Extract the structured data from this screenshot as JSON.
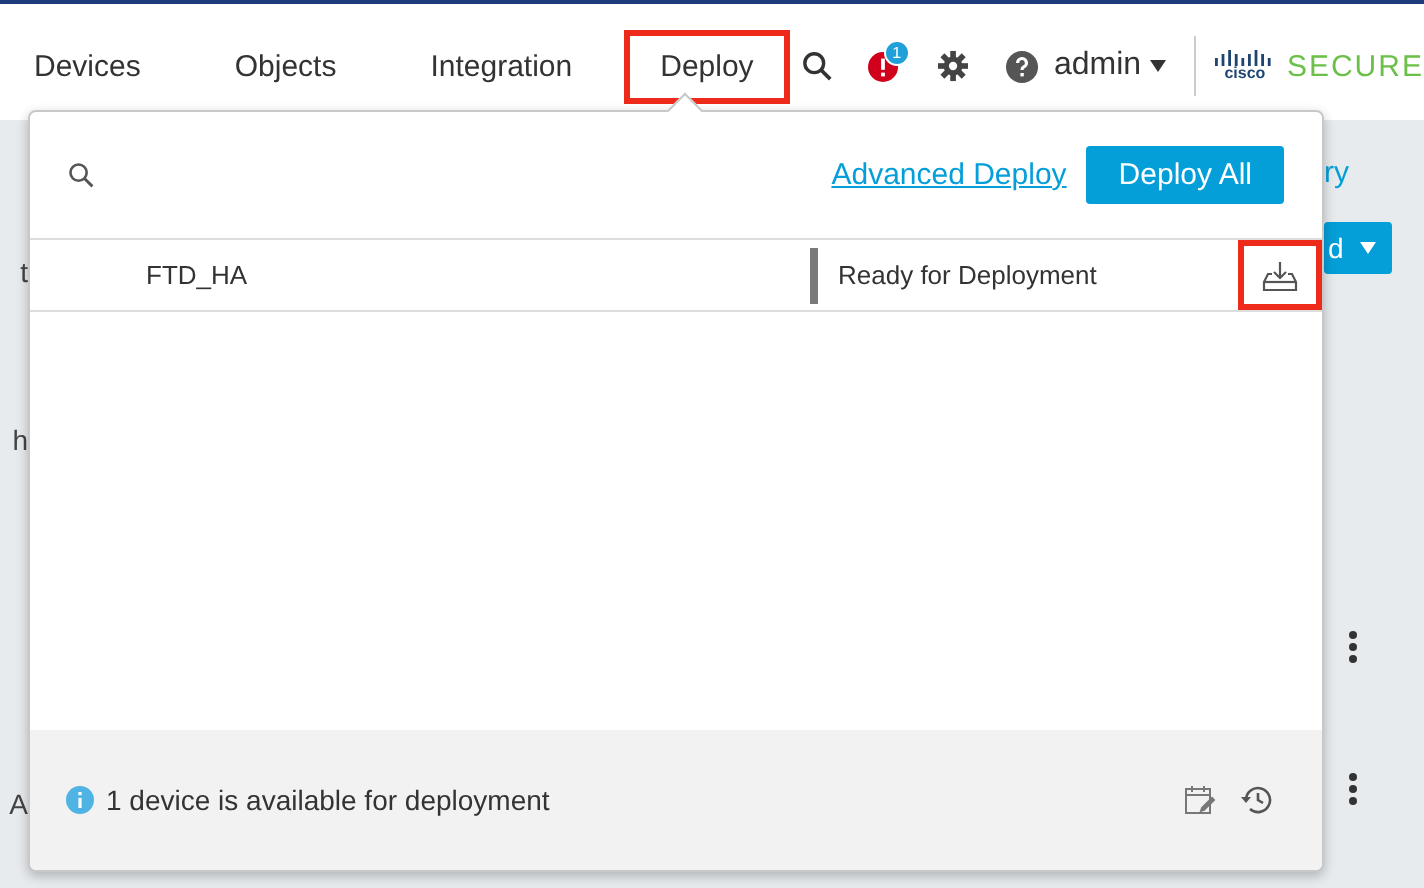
{
  "nav": {
    "items": [
      {
        "label": "Devices",
        "highlighted": false
      },
      {
        "label": "Objects",
        "highlighted": false
      },
      {
        "label": "Integration",
        "highlighted": false
      },
      {
        "label": "Deploy",
        "highlighted": true
      }
    ],
    "alert_count": "1",
    "user": "admin",
    "logo_text": "cisco",
    "brand": "SECURE"
  },
  "background": {
    "left_fragments": [
      "t",
      "h",
      "A"
    ],
    "right_link": "ry",
    "right_button": "d"
  },
  "deploy_panel": {
    "advanced_link": "Advanced Deploy",
    "deploy_all": "Deploy All",
    "devices": [
      {
        "name": "FTD_HA",
        "status": "Ready for Deployment",
        "highlighted": true
      }
    ],
    "footer_message": "1 device is available for deployment"
  }
}
